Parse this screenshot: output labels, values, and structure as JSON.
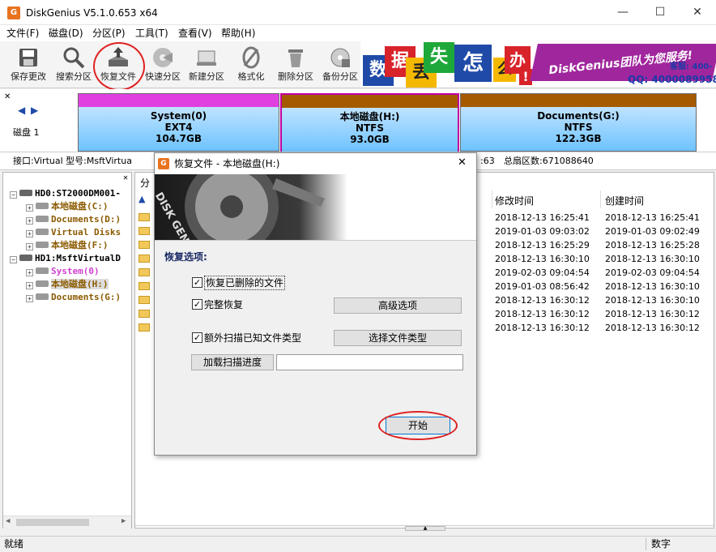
{
  "window": {
    "title": "DiskGenius V5.1.0.653 x64",
    "icon_letter": "G",
    "minimize": "—",
    "maximize": "☐",
    "close": "✕"
  },
  "menu": [
    "文件(F)",
    "磁盘(D)",
    "分区(P)",
    "工具(T)",
    "查看(V)",
    "帮助(H)"
  ],
  "toolbar": [
    {
      "label": "保存更改",
      "icon": "save-icon"
    },
    {
      "label": "搜索分区",
      "icon": "search-icon"
    },
    {
      "label": "恢复文件",
      "icon": "recover-icon"
    },
    {
      "label": "快速分区",
      "icon": "quick-partition-icon"
    },
    {
      "label": "新建分区",
      "icon": "new-partition-icon"
    },
    {
      "label": "格式化",
      "icon": "format-icon"
    },
    {
      "label": "删除分区",
      "icon": "delete-icon"
    },
    {
      "label": "备份分区",
      "icon": "backup-icon"
    }
  ],
  "banner": {
    "chars": [
      "数",
      "据",
      "丢",
      "失",
      "怎",
      "么",
      "办",
      "!"
    ],
    "slogan": "DiskGenius团队为您服务!",
    "phone": "客服: 400-",
    "qq": "QQ: 4000089958"
  },
  "diskmap": {
    "disk_label": "磁盘 1",
    "partitions": [
      {
        "name": "System(0)",
        "fs": "EXT4",
        "size": "104.7GB",
        "color": "#e040e0"
      },
      {
        "name": "本地磁盘(H:)",
        "fs": "NTFS",
        "size": "93.0GB",
        "color": "#a55a00"
      },
      {
        "name": "Documents(G:)",
        "fs": "NTFS",
        "size": "122.3GB",
        "color": "#a55a00"
      }
    ]
  },
  "infobar": {
    "left": "接口:Virtual  型号:MsftVirtua",
    "right_num": ":63",
    "sectors": "总扇区数:671088640"
  },
  "tree": {
    "nodes": [
      {
        "label": "HD0:ST2000DM001-",
        "level": 0,
        "type": "disk"
      },
      {
        "label": "本地磁盘(C:)",
        "level": 1,
        "type": "vol"
      },
      {
        "label": "Documents(D:)",
        "level": 1,
        "type": "vol"
      },
      {
        "label": "Virtual Disks",
        "level": 1,
        "type": "vol"
      },
      {
        "label": "本地磁盘(F:)",
        "level": 1,
        "type": "vol"
      },
      {
        "label": "HD1:MsftVirtualD",
        "level": 0,
        "type": "disk"
      },
      {
        "label": "System(0)",
        "level": 1,
        "type": "sys"
      },
      {
        "label": "本地磁盘(H:)",
        "level": 1,
        "type": "vol-selected"
      },
      {
        "label": "Documents(G:)",
        "level": 1,
        "type": "vol"
      }
    ]
  },
  "list": {
    "tab_label": "分",
    "columns": {
      "modified": "修改时间",
      "created": "创建时间"
    },
    "rows": [
      {
        "modified": "2018-12-13  16:25:41",
        "created": "2018-12-13  16:25:41"
      },
      {
        "modified": "2019-01-03  09:03:02",
        "created": "2019-01-03  09:02:49"
      },
      {
        "modified": "2018-12-13  16:25:29",
        "created": "2018-12-13  16:25:28"
      },
      {
        "modified": "2018-12-13  16:30:10",
        "created": "2018-12-13  16:30:10"
      },
      {
        "modified": "2019-02-03  09:04:54",
        "created": "2019-02-03  09:04:54"
      },
      {
        "modified": "2019-01-03  08:56:42",
        "created": "2018-12-13  16:30:10"
      },
      {
        "modified": "2018-12-13  16:30:12",
        "created": "2018-12-13  16:30:10"
      },
      {
        "modified": "2018-12-13  16:30:12",
        "created": "2018-12-13  16:30:12"
      },
      {
        "modified": "2018-12-13  16:30:12",
        "created": "2018-12-13  16:30:12"
      }
    ]
  },
  "statusbar": {
    "left": "就绪",
    "right": "数字"
  },
  "dialog": {
    "title": "恢复文件 - 本地磁盘(H:)",
    "hero_text": "DISK GENIUS",
    "section": "恢复选项:",
    "opt_deleted": "恢复已删除的文件",
    "opt_full": "完整恢复",
    "opt_extra": "额外扫描已知文件类型",
    "btn_advanced": "高级选项",
    "btn_select_types": "选择文件类型",
    "btn_load_progress": "加载扫描进度",
    "btn_start": "开始",
    "check_mark": "✓",
    "close": "✕"
  }
}
